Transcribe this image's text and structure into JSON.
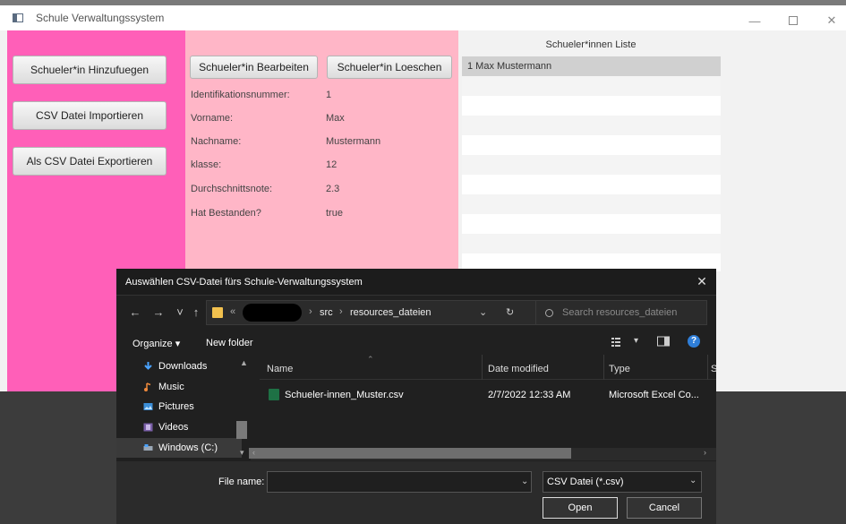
{
  "window": {
    "title": "Schule Verwaltungssystem",
    "controls": {
      "minimize": "—",
      "close": "✕"
    }
  },
  "left_buttons": [
    "Schueler*in Hinzufuegen",
    "CSV Datei Importieren",
    "Als CSV Datei Exportieren"
  ],
  "mid": {
    "edit_button": "Schueler*in Bearbeiten",
    "delete_button": "Schueler*in Loeschen",
    "fields": [
      {
        "label": "Identifikationsnummer:",
        "value": "1"
      },
      {
        "label": "Vorname:",
        "value": "Max"
      },
      {
        "label": "Nachname:",
        "value": "Mustermann"
      },
      {
        "label": "klasse:",
        "value": "12"
      },
      {
        "label": "Durchschnittsnote:",
        "value": "2.3"
      },
      {
        "label": "Hat Bestanden?",
        "value": "true"
      }
    ]
  },
  "list": {
    "title": "Schueler*innen Liste",
    "items": [
      "1 Max Mustermann"
    ]
  },
  "dialog": {
    "title": "Auswählen CSV-Datei fürs Schule-Verwaltungssystem",
    "close": "✕",
    "nav": {
      "back": "←",
      "forward": "→",
      "recent": "˅",
      "up": "↑"
    },
    "breadcrumb": [
      "src",
      "resources_dateien"
    ],
    "search_placeholder": "Search resources_dateien",
    "organize": "Organize ▾",
    "new_folder": "New folder",
    "help": "?",
    "nav_items": [
      {
        "label": "Downloads",
        "icon": "download-arrow-icon"
      },
      {
        "label": "Music",
        "icon": "music-note-icon"
      },
      {
        "label": "Pictures",
        "icon": "pictures-icon"
      },
      {
        "label": "Videos",
        "icon": "videos-icon"
      },
      {
        "label": "Windows (C:)",
        "icon": "drive-icon"
      }
    ],
    "columns": [
      "Name",
      "Date modified",
      "Type",
      "S"
    ],
    "files": [
      {
        "name": "Schueler-innen_Muster.csv",
        "date": "2/7/2022 12:33 AM",
        "type": "Microsoft Excel Co..."
      }
    ],
    "file_name_label": "File name:",
    "file_name_value": "",
    "filter": "CSV Datei (*.csv)",
    "open_button": "Open",
    "cancel_button": "Cancel"
  },
  "colors": {
    "left_panel": "#ff5fb8",
    "mid_panel": "#ffb6c7",
    "dialog_bg": "#202020"
  }
}
